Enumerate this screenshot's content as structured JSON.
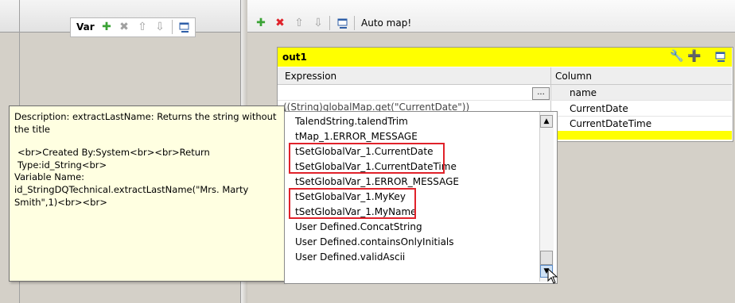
{
  "var_panel": {
    "title": "Var"
  },
  "right_toolbar": {
    "automap_label": "Auto map!"
  },
  "out1": {
    "title": "out1",
    "columns": {
      "expression": "Expression",
      "column": "Column"
    },
    "rows": [
      {
        "expression": "",
        "column": "name"
      },
      {
        "expression": "((String)globalMap.get(\"CurrentDate\"))",
        "column": "CurrentDate"
      },
      {
        "expression": "",
        "column": "CurrentDateTime"
      }
    ],
    "ellipsis": "..."
  },
  "tooltip": {
    "line1": "Description: extractLastName: Returns the string without the title",
    "line2": "<br>Created By:System<br><br>Return Type:id_String<br>",
    "line3": "Variable Name: id_StringDQTechnical.extractLastName(\"Mrs. Marty Smith\",1)<br><br>"
  },
  "autocomplete": {
    "items": [
      "TalendString.talendTrim",
      "tMap_1.ERROR_MESSAGE",
      "tSetGlobalVar_1.CurrentDate",
      "tSetGlobalVar_1.CurrentDateTime",
      "tSetGlobalVar_1.ERROR_MESSAGE",
      "tSetGlobalVar_1.MyKey",
      "tSetGlobalVar_1.MyName",
      "User Defined.ConcatString",
      "User Defined.containsOnlyInitials",
      "User Defined.validAscii"
    ]
  },
  "colors": {
    "out1_header": "#ffff00",
    "highlight_border": "#e0222a",
    "tooltip_bg": "#ffffe1"
  }
}
